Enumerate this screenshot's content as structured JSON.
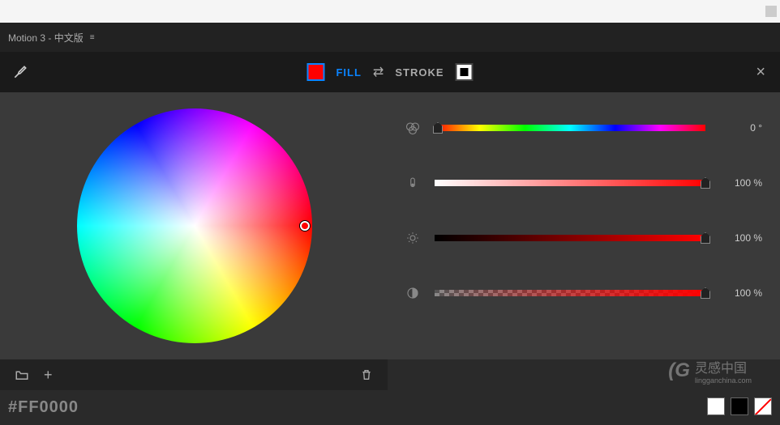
{
  "title": "Motion 3 - 中文版",
  "toolbar": {
    "fill_label": "FILL",
    "stroke_label": "STROKE",
    "fill_color": "#ff0000"
  },
  "sliders": {
    "hue": {
      "value": "0 °",
      "handle_pos": "0%"
    },
    "saturation": {
      "value": "100 %",
      "handle_pos": "100%"
    },
    "brightness": {
      "value": "100 %",
      "handle_pos": "100%"
    },
    "alpha": {
      "value": "100 %",
      "handle_pos": "100%"
    }
  },
  "hex": "#FF0000",
  "watermark": {
    "name": "灵感中国",
    "url": "lingganchina.com"
  },
  "presets": {
    "white": "#ffffff",
    "black": "#000000"
  }
}
